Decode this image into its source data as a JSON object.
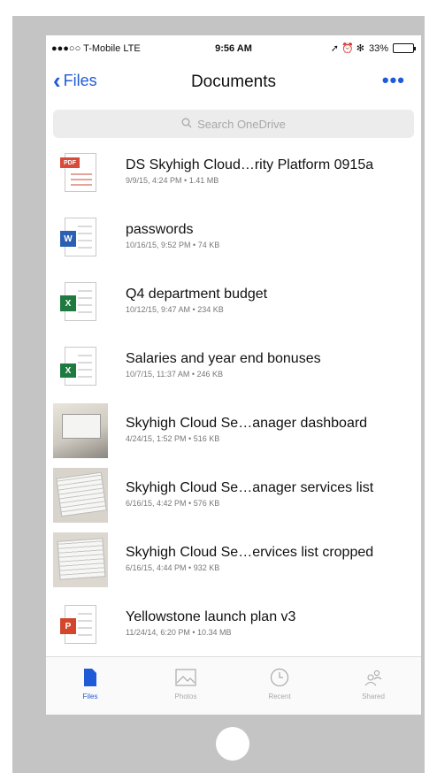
{
  "status_bar": {
    "carrier": "●●●○○ T-Mobile  LTE",
    "time": "9:56 AM",
    "indicators": "➚ ⏰ ✻",
    "battery": "33%"
  },
  "nav": {
    "back_label": "Files",
    "title": "Documents",
    "more_label": "•••"
  },
  "search": {
    "placeholder": "Search OneDrive"
  },
  "files": [
    {
      "name": "DS Skyhigh Cloud…rity Platform 0915a",
      "meta": "9/9/15, 4:24 PM • 1.41 MB",
      "icon": "pdf-icon"
    },
    {
      "name": "passwords",
      "meta": "10/16/15, 9:52 PM • 74 KB",
      "icon": "word-icon"
    },
    {
      "name": "Q4 department budget",
      "meta": "10/12/15, 9:47 AM • 234 KB",
      "icon": "excel-icon"
    },
    {
      "name": "Salaries and year end bonuses",
      "meta": "10/7/15, 11:37 AM • 246 KB",
      "icon": "excel-icon"
    },
    {
      "name": "Skyhigh Cloud Se…anager dashboard",
      "meta": "4/24/15, 1:52 PM • 516 KB",
      "icon": "photo-thumbnail"
    },
    {
      "name": "Skyhigh Cloud Se…anager services list",
      "meta": "6/16/15, 4:42 PM • 576 KB",
      "icon": "photo-thumbnail"
    },
    {
      "name": "Skyhigh Cloud Se…ervices list cropped",
      "meta": "6/16/15, 4:44 PM • 932 KB",
      "icon": "photo-thumbnail"
    },
    {
      "name": "Yellowstone launch plan v3",
      "meta": "11/24/14, 6:20 PM • 10.34 MB",
      "icon": "powerpoint-icon"
    }
  ],
  "tabs": [
    {
      "label": "Files",
      "icon": "files-icon",
      "active": true
    },
    {
      "label": "Photos",
      "icon": "photos-icon",
      "active": false
    },
    {
      "label": "Recent",
      "icon": "clock-icon",
      "active": false
    },
    {
      "label": "Shared",
      "icon": "shared-people-icon",
      "active": false
    }
  ],
  "colors": {
    "accent": "#1f5bd6",
    "frame": "#c4c4c4",
    "pdf": "#d84a3a",
    "word": "#2b5fb3",
    "excel": "#1e7a3e",
    "powerpoint": "#d2472b"
  }
}
